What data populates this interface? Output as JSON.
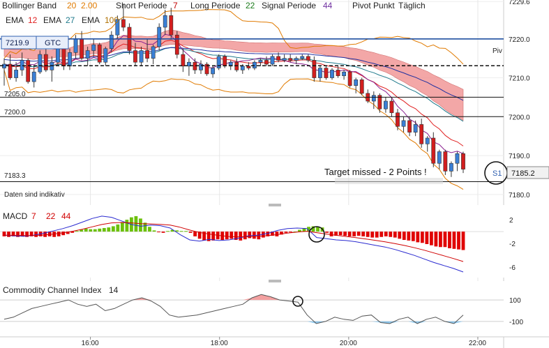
{
  "colors": {
    "bb": "#e07a00",
    "ema12": "#e02020",
    "ema27": "#1f7a8c",
    "ema100": "#b07000",
    "short": "#c00000",
    "long": "#1a7a1a",
    "signal": "#7030a0",
    "purple": "#8b2090",
    "cloud": "#f08a8a",
    "cloud_blue": "#6fa8e8",
    "up": "#3a7fd5",
    "down": "#d21e1e",
    "macd_pos": "#6cc00a",
    "macd_neg": "#e00000",
    "macd_line": "#2a2ad0",
    "signal_line": "#d00000",
    "cci_pos": "#f3a0a0",
    "cci_neg": "#8ec8ee"
  },
  "header": {
    "bb": {
      "label": "Bollinger Band",
      "p1": "20",
      "p2": "2.00"
    },
    "short": {
      "label": "Short Periode",
      "value": "7"
    },
    "long": {
      "label": "Long Periode",
      "value": "22"
    },
    "signal": {
      "label": "Signal Periode",
      "value": "44"
    },
    "pivot": {
      "label": "Pivot Punkt",
      "value": "Täglich"
    },
    "ema_a": {
      "label": "EMA",
      "value": "12"
    },
    "ema_b": {
      "label": "EMA",
      "value": "27"
    },
    "ema_c": {
      "label": "EMA",
      "value": "100"
    }
  },
  "order": {
    "price": "7219.9",
    "type": "GTC"
  },
  "pivot_tag": "Piv",
  "levels": {
    "r": "7205.0",
    "p": "7200.0",
    "s": "7183.3"
  },
  "annotation": "Target missed - 2 Points !",
  "disclaimer": "Daten sind indikativ",
  "s1": {
    "label": "S1",
    "value": "7185.2"
  },
  "price_ticks": [
    "7229.6",
    "7220.0",
    "7210.0",
    "7200.0",
    "7190.0",
    "7180.0"
  ],
  "macd": {
    "label": "MACD",
    "p1": "7",
    "p2": "22",
    "p3": "44",
    "ticks": [
      "2",
      "-2",
      "-6"
    ]
  },
  "cci": {
    "label": "Commodity Channel Index",
    "period": "14",
    "ticks": [
      "100",
      "-100"
    ]
  },
  "time_ticks": [
    "16:00",
    "18:00",
    "20:00",
    "22:00"
  ],
  "chart_data": {
    "type": "candlestick",
    "y_range": [
      7178,
      7230
    ],
    "x_range_hours": [
      14.6,
      22.4
    ],
    "horizontal_lines": [
      7220.0,
      7219.9,
      7205.0,
      7200.0,
      7183.3
    ],
    "candles": [
      [
        7212.5,
        7215.0,
        7208.0,
        7213.5
      ],
      [
        7213.5,
        7216.0,
        7209.5,
        7210.0
      ],
      [
        7210.0,
        7214.0,
        7209.0,
        7212.0
      ],
      [
        7212.0,
        7216.5,
        7210.5,
        7214.5
      ],
      [
        7214.5,
        7215.0,
        7208.5,
        7209.0
      ],
      [
        7209.0,
        7213.0,
        7207.5,
        7211.5
      ],
      [
        7211.5,
        7217.0,
        7211.0,
        7216.0
      ],
      [
        7216.0,
        7218.0,
        7211.5,
        7212.0
      ],
      [
        7212.0,
        7215.5,
        7209.0,
        7214.0
      ],
      [
        7214.0,
        7219.0,
        7213.0,
        7218.0
      ],
      [
        7218.0,
        7219.5,
        7212.0,
        7213.0
      ],
      [
        7213.0,
        7217.5,
        7212.0,
        7216.5
      ],
      [
        7216.5,
        7221.0,
        7215.0,
        7220.0
      ],
      [
        7220.0,
        7222.0,
        7214.5,
        7215.0
      ],
      [
        7215.0,
        7218.0,
        7213.0,
        7217.0
      ],
      [
        7217.0,
        7220.0,
        7215.5,
        7218.5
      ],
      [
        7218.5,
        7219.0,
        7213.5,
        7214.0
      ],
      [
        7214.0,
        7218.0,
        7213.0,
        7217.5
      ],
      [
        7217.5,
        7222.0,
        7216.5,
        7221.0
      ],
      [
        7221.0,
        7226.0,
        7220.0,
        7225.0
      ],
      [
        7225.0,
        7229.0,
        7222.0,
        7223.0
      ],
      [
        7223.0,
        7224.0,
        7216.0,
        7217.0
      ],
      [
        7217.0,
        7219.0,
        7213.0,
        7214.0
      ],
      [
        7214.0,
        7218.0,
        7213.0,
        7217.0
      ],
      [
        7217.0,
        7220.0,
        7214.0,
        7215.0
      ],
      [
        7215.0,
        7218.5,
        7213.5,
        7218.0
      ],
      [
        7218.0,
        7224.0,
        7217.0,
        7223.0
      ],
      [
        7223.0,
        7227.5,
        7221.0,
        7226.0
      ],
      [
        7226.0,
        7228.0,
        7220.0,
        7221.0
      ],
      [
        7221.0,
        7222.0,
        7215.0,
        7216.0
      ],
      [
        7216.0,
        7217.5,
        7211.5,
        7213.0
      ],
      [
        7213.0,
        7215.0,
        7210.5,
        7214.0
      ],
      [
        7214.0,
        7215.0,
        7211.0,
        7212.0
      ],
      [
        7212.0,
        7214.5,
        7211.0,
        7213.5
      ],
      [
        7213.5,
        7214.0,
        7210.5,
        7211.0
      ],
      [
        7211.0,
        7213.0,
        7210.0,
        7212.5
      ],
      [
        7212.5,
        7216.0,
        7212.0,
        7215.5
      ],
      [
        7215.5,
        7216.0,
        7212.5,
        7213.0
      ],
      [
        7213.0,
        7214.5,
        7212.0,
        7214.0
      ],
      [
        7214.0,
        7215.0,
        7211.5,
        7212.0
      ],
      [
        7212.0,
        7213.5,
        7211.0,
        7213.0
      ],
      [
        7213.0,
        7214.0,
        7212.0,
        7212.5
      ],
      [
        7212.5,
        7214.5,
        7212.0,
        7214.0
      ],
      [
        7214.0,
        7215.0,
        7213.0,
        7214.5
      ],
      [
        7214.5,
        7215.5,
        7213.0,
        7213.5
      ],
      [
        7213.5,
        7216.0,
        7213.0,
        7215.5
      ],
      [
        7215.5,
        7216.5,
        7214.0,
        7214.5
      ],
      [
        7214.5,
        7216.0,
        7214.0,
        7215.0
      ],
      [
        7215.0,
        7216.0,
        7214.0,
        7214.5
      ],
      [
        7214.5,
        7215.5,
        7213.5,
        7215.0
      ],
      [
        7215.0,
        7216.0,
        7214.5,
        7215.5
      ],
      [
        7215.5,
        7216.0,
        7214.0,
        7214.5
      ],
      [
        7214.5,
        7215.5,
        7209.0,
        7210.0
      ],
      [
        7210.0,
        7213.0,
        7209.0,
        7212.5
      ],
      [
        7212.5,
        7213.0,
        7209.5,
        7210.0
      ],
      [
        7210.0,
        7212.5,
        7209.5,
        7212.0
      ],
      [
        7212.0,
        7213.0,
        7210.0,
        7210.5
      ],
      [
        7210.5,
        7212.0,
        7209.5,
        7211.5
      ],
      [
        7211.5,
        7212.0,
        7207.5,
        7208.0
      ],
      [
        7208.0,
        7210.0,
        7206.0,
        7209.5
      ],
      [
        7209.5,
        7210.0,
        7205.5,
        7206.0
      ],
      [
        7206.0,
        7207.0,
        7203.5,
        7204.0
      ],
      [
        7204.0,
        7206.5,
        7202.0,
        7205.5
      ],
      [
        7205.5,
        7206.0,
        7201.0,
        7202.0
      ],
      [
        7202.0,
        7205.0,
        7201.0,
        7204.0
      ],
      [
        7204.0,
        7205.0,
        7200.0,
        7201.0
      ],
      [
        7201.0,
        7202.0,
        7196.5,
        7197.5
      ],
      [
        7197.5,
        7200.0,
        7196.0,
        7199.0
      ],
      [
        7199.0,
        7200.0,
        7195.0,
        7196.0
      ],
      [
        7196.0,
        7199.0,
        7195.0,
        7198.0
      ],
      [
        7198.0,
        7199.5,
        7192.0,
        7193.0
      ],
      [
        7193.0,
        7195.0,
        7191.0,
        7194.5
      ],
      [
        7194.5,
        7196.0,
        7187.0,
        7188.0
      ],
      [
        7188.0,
        7191.5,
        7186.5,
        7191.0
      ],
      [
        7191.0,
        7191.5,
        7185.0,
        7186.0
      ],
      [
        7186.0,
        7188.5,
        7184.5,
        7188.0
      ],
      [
        7188.0,
        7191.0,
        7186.0,
        7190.5
      ],
      [
        7190.5,
        7191.0,
        7185.5,
        7186.5
      ]
    ],
    "macd_histogram": [
      -0.8,
      -0.9,
      -0.8,
      -0.9,
      -0.8,
      -0.9,
      -0.8,
      -0.9,
      -0.8,
      -0.9,
      -0.8,
      -0.9,
      -0.8,
      -0.6,
      -0.4,
      -0.2,
      0.1,
      0.3,
      0.5,
      0.4,
      0.4,
      0.5,
      0.6,
      0.7,
      0.9,
      1.2,
      1.6,
      2.0,
      2.4,
      2.6,
      2.2,
      1.5,
      0.8,
      0.2,
      -0.1,
      -0.2,
      0.1,
      0.3,
      0.2,
      0.1,
      0.1,
      -0.2,
      -0.8,
      -1.2,
      -1.5,
      -1.6,
      -1.5,
      -1.3,
      -1.4,
      -1.3,
      -1.2,
      -1.4,
      -1.5,
      -1.3,
      -1.1,
      -1.2,
      -1.3,
      -1.0,
      -0.8,
      -0.7,
      -0.8,
      -0.5,
      -0.2,
      -0.1,
      0.0,
      0.3,
      0.6,
      0.8,
      0.9,
      0.8,
      0.7,
      -0.2,
      -0.8,
      -0.7,
      -0.6,
      -0.7,
      -0.8,
      -0.8,
      -0.7,
      -0.8,
      -0.9,
      -1.0,
      -1.0,
      -0.9,
      -0.8,
      -0.9,
      -1.0,
      -1.2,
      -1.4,
      -1.5,
      -1.6,
      -1.8,
      -1.9,
      -2.1,
      -2.3,
      -2.5,
      -2.6,
      -2.6,
      -2.8,
      -2.9,
      -3.0,
      -3.1
    ],
    "macd_line": [
      -0.6,
      -0.7,
      -0.8,
      -0.6,
      -0.3,
      0.1,
      0.5,
      1.0,
      1.6,
      2.2,
      2.6,
      2.4,
      1.8,
      1.2,
      0.9,
      1.1,
      1.0,
      0.6,
      -0.5,
      -1.4,
      -1.6,
      -1.3,
      -1.5,
      -1.4,
      -1.1,
      -0.7,
      -0.6,
      -0.3,
      0.2,
      0.5,
      0.6,
      0.5,
      -1.0,
      -1.2,
      -1.4,
      -1.5,
      -1.7,
      -2.0,
      -2.3,
      -2.6,
      -3.0,
      -3.5,
      -4.0,
      -4.6,
      -5.2,
      -5.7,
      -6.2,
      -6.8
    ],
    "cci": [
      -80,
      -60,
      -20,
      20,
      40,
      60,
      80,
      100,
      60,
      40,
      60,
      0,
      20,
      60,
      100,
      120,
      90,
      40,
      -40,
      -60,
      -50,
      -40,
      -20,
      0,
      20,
      40,
      60,
      120,
      150,
      130,
      100,
      90,
      80,
      -40,
      -120,
      -100,
      -60,
      -80,
      -90,
      -50,
      -40,
      -110,
      -120,
      -80,
      -60,
      -120,
      -80,
      -60,
      -100,
      -120,
      -40
    ],
    "cci_range": [
      -230,
      230
    ]
  }
}
